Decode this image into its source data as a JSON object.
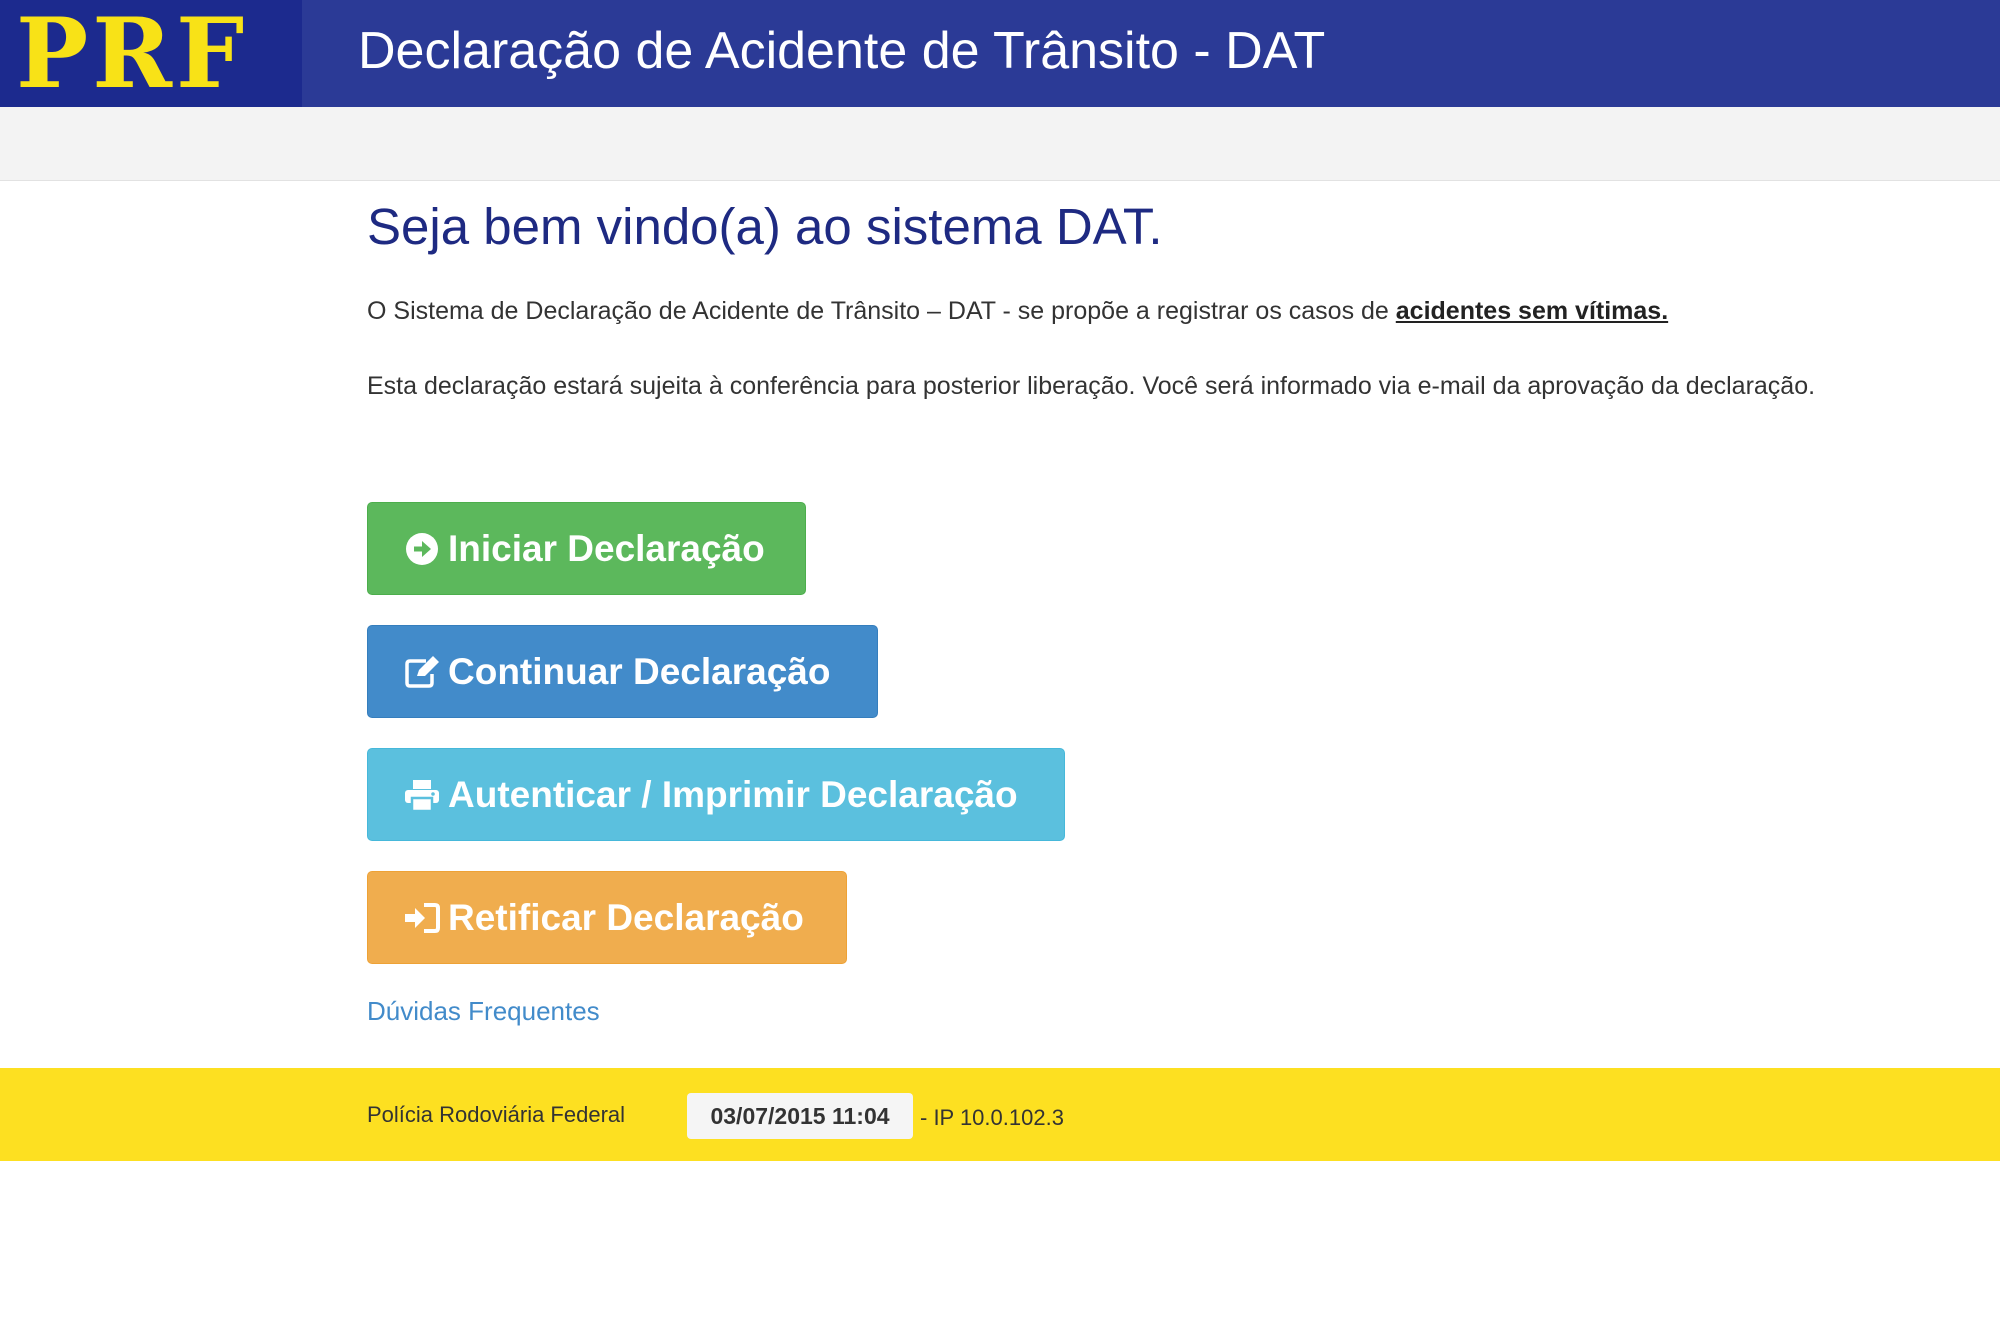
{
  "header": {
    "logo_text": "PRF",
    "title": "Declaração de Acidente de Trânsito - DAT"
  },
  "main": {
    "welcome": "Seja bem vindo(a) ao sistema DAT.",
    "para1_text": "O Sistema de Declaração de Acidente de Trânsito – DAT - se propõe a registrar os casos de ",
    "para1_bold": "acidentes sem vítimas.",
    "para2": "Esta declaração estará sujeita à conferência para posterior liberação. Você será informado via e-mail da aprovação da declaração.",
    "buttons": [
      {
        "label": "Iniciar Declaração",
        "icon": "arrow-circle-right-icon",
        "color": "#5cb85c"
      },
      {
        "label": "Continuar Declaração",
        "icon": "edit-icon",
        "color": "#428bca"
      },
      {
        "label": "Autenticar / Imprimir Declaração",
        "icon": "print-icon",
        "color": "#5bc0de"
      },
      {
        "label": "Retificar Declaração",
        "icon": "sign-in-icon",
        "color": "#f0ad4e"
      }
    ],
    "faq_link": "Dúvidas Frequentes"
  },
  "footer": {
    "org": "Polícia Rodoviária Federal",
    "timestamp": "03/07/2015 11:04",
    "ip": "- IP 10.0.102.3"
  },
  "colors": {
    "header_bg": "#2b3a96",
    "logo_yellow": "#f8e217",
    "footer_bg": "#fde021",
    "title_blue": "#1e2a82"
  }
}
